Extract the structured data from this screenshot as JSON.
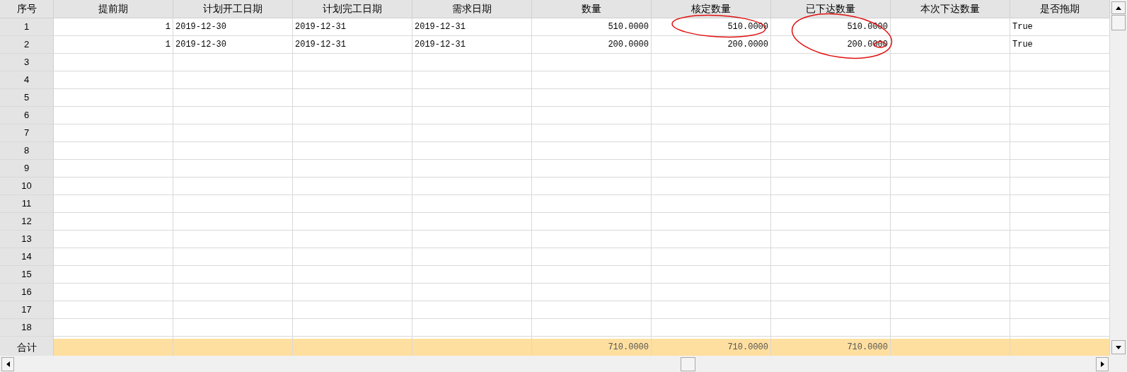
{
  "table": {
    "columns": [
      "序号",
      "提前期",
      "计划开工日期",
      "计划完工日期",
      "需求日期",
      "数量",
      "核定数量",
      "已下达数量",
      "本次下达数量",
      "是否拖期"
    ],
    "rows": [
      {
        "number": "1",
        "lead_period": "1",
        "planned_start": "2019-12-30",
        "planned_finish": "2019-12-31",
        "demand_date": "2019-12-31",
        "quantity": "510.0000",
        "approved_quantity": "510.0000",
        "issued_quantity": "510.0000",
        "overdue": "True"
      },
      {
        "number": "2",
        "lead_period": "1",
        "planned_start": "2019-12-30",
        "planned_finish": "2019-12-31",
        "demand_date": "2019-12-31",
        "quantity": "200.0000",
        "approved_quantity": "200.0000",
        "issued_quantity": "200.0000",
        "overdue": "True"
      },
      {
        "number": "3"
      },
      {
        "number": "4"
      },
      {
        "number": "5"
      },
      {
        "number": "6"
      },
      {
        "number": "7"
      },
      {
        "number": "8"
      },
      {
        "number": "9"
      },
      {
        "number": "10"
      },
      {
        "number": "11"
      },
      {
        "number": "12"
      },
      {
        "number": "13"
      },
      {
        "number": "14"
      },
      {
        "number": "15"
      },
      {
        "number": "16"
      },
      {
        "number": "17"
      },
      {
        "number": "18"
      }
    ],
    "total_row": {
      "label": "合计",
      "quantity": "710.0000",
      "approved_quantity": "710.0000",
      "issued_quantity": "710.0000"
    }
  }
}
